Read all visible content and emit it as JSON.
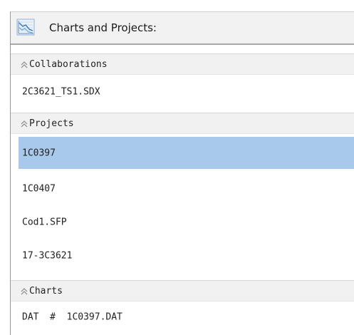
{
  "panel": {
    "title": "Charts and Projects:",
    "title_icon": "line-chart-icon"
  },
  "sections": {
    "collaborations": {
      "header": "Collaborations",
      "items": [
        "2C3621_TS1.SDX"
      ]
    },
    "projects": {
      "header": "Projects",
      "items": [
        "1C0397",
        "1C0407",
        "Cod1.SFP",
        "17-3C3621"
      ],
      "selected_index": 0
    },
    "charts": {
      "header": "Charts",
      "items": [
        "DAT  #  1C0397.DAT"
      ]
    }
  },
  "colors": {
    "selection": "#a8c9ec",
    "header_background": "#f1f1f1",
    "title_background": "#f2f2f2"
  },
  "icons": {
    "collapse": "double-chevron-up-icon"
  }
}
